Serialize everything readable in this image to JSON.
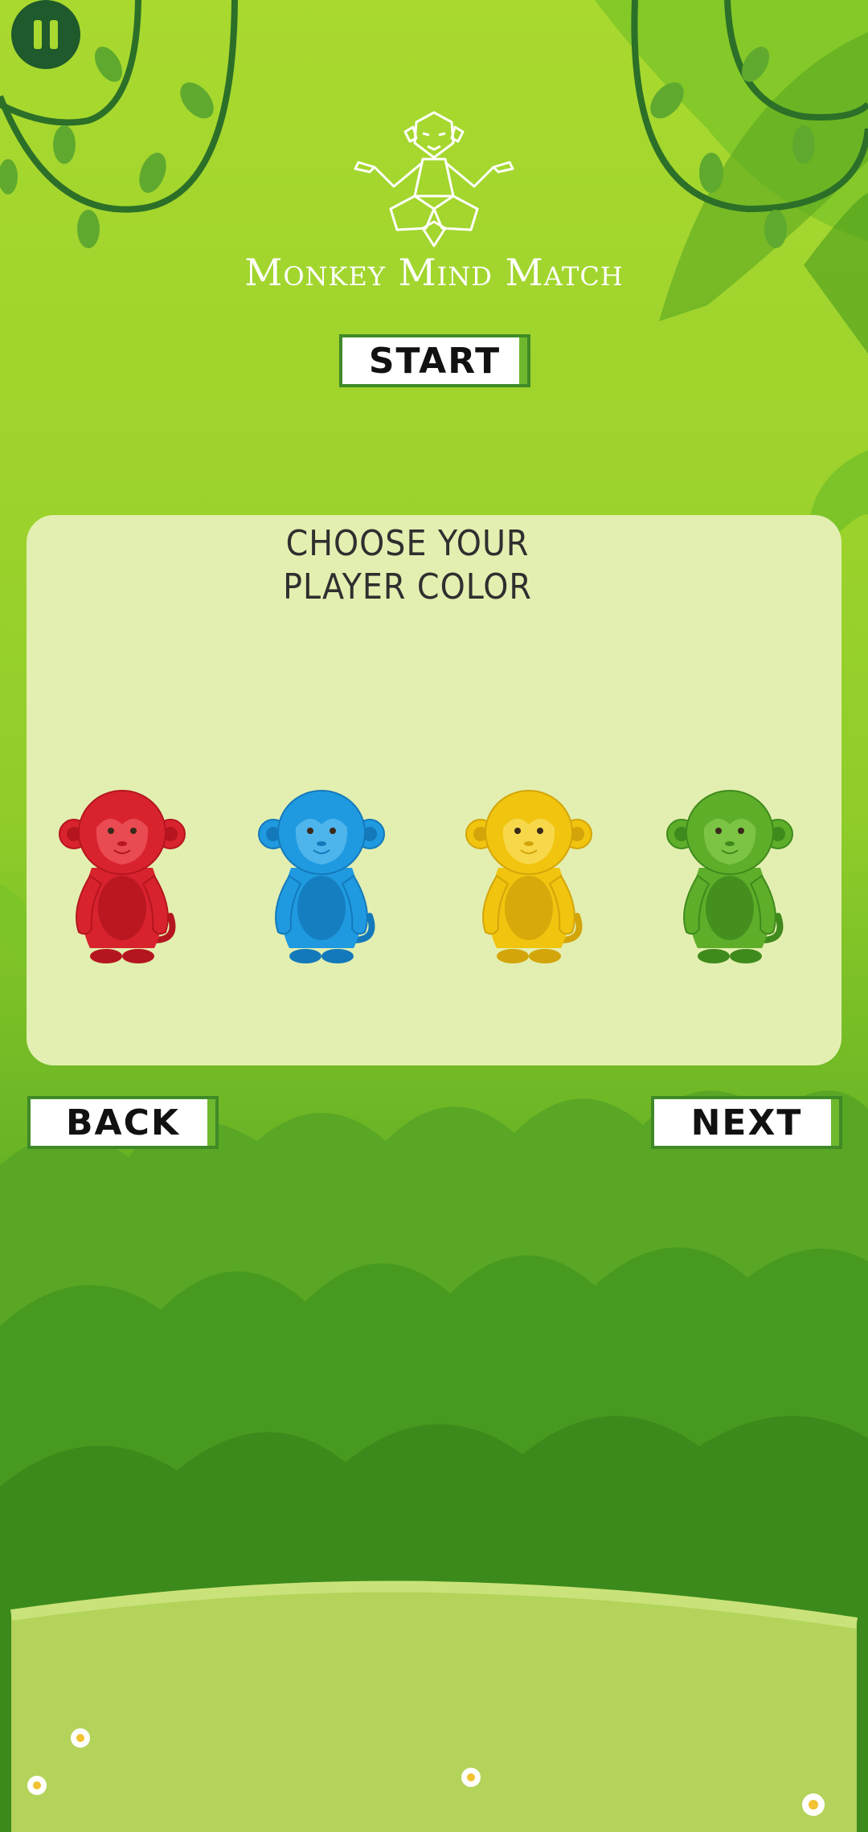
{
  "game": {
    "title": "Monkey Mind Match"
  },
  "buttons": {
    "start_label": "START",
    "back_label": "BACK",
    "next_label": "NEXT"
  },
  "panel": {
    "title_line1": "CHOOSE YOUR",
    "title_line2": "PLAYER COLOR"
  },
  "player_colors": [
    {
      "name": "red",
      "body": "#d8232f",
      "dark": "#b5151f",
      "light": "#ea4a52"
    },
    {
      "name": "blue",
      "body": "#1f9ae0",
      "dark": "#1479bb",
      "light": "#4db4ec"
    },
    {
      "name": "yellow",
      "body": "#f1c40f",
      "dark": "#d3a50a",
      "light": "#f7d84a"
    },
    {
      "name": "green",
      "body": "#5fae2a",
      "dark": "#3f8a1c",
      "light": "#7cc444"
    }
  ],
  "icons": {
    "pause": "pause-icon",
    "logo": "meditating-monkey-logo"
  },
  "colors": {
    "button_border": "#3f8a27",
    "panel_bg": "#e3efb0",
    "pause_bg": "#1f5a2c"
  }
}
